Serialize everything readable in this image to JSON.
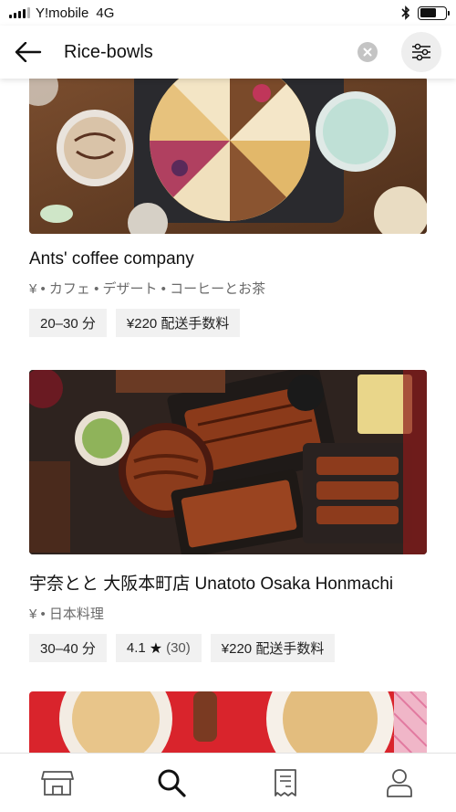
{
  "status_bar": {
    "carrier": "Y!mobile",
    "network": "4G",
    "battery_level": 0.65
  },
  "header": {
    "search_query": "Rice-bowls",
    "back_icon": "arrow-left-icon",
    "clear_icon": "clear-x-icon",
    "filter_icon": "filter-sliders-icon"
  },
  "restaurants": [
    {
      "name": "Ants' coffee company",
      "meta": "¥ • カフェ • デザート • コーヒーとお茶",
      "delivery_time": "20–30 分",
      "delivery_fee": "¥220 配送手数料"
    },
    {
      "name": "宇奈とと 大阪本町店 Unatoto Osaka Honmachi",
      "meta": "¥ • 日本料理",
      "delivery_time": "30–40 分",
      "rating": "4.1",
      "rating_count": "(30)",
      "delivery_fee": "¥220 配送手数料"
    }
  ],
  "bottom_nav": [
    {
      "icon": "storefront-icon",
      "active": false
    },
    {
      "icon": "search-icon",
      "active": true
    },
    {
      "icon": "receipt-icon",
      "active": false
    },
    {
      "icon": "person-icon",
      "active": false
    }
  ],
  "colors": {
    "chip_bg": "#f1f1f1",
    "text": "#111111",
    "muted": "#6b6b6b"
  }
}
